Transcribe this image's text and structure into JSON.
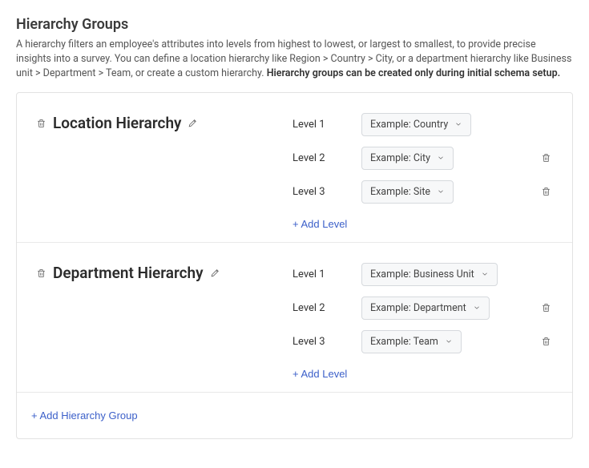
{
  "header": {
    "title": "Hierarchy Groups",
    "description": "A hierarchy filters an employee's attributes into levels from highest to lowest, or largest to smallest, to provide precise insights into a survey. You can define a location hierarchy like Region > Country > City, or a department hierarchy like Business unit > Department > Team, or create a custom hierarchy. ",
    "description_bold": "Hierarchy groups can be created only during initial schema setup."
  },
  "groups": [
    {
      "name": "Location Hierarchy",
      "levels": [
        {
          "label": "Level 1",
          "value": "Example: Country",
          "deletable": false
        },
        {
          "label": "Level 2",
          "value": "Example: City",
          "deletable": true
        },
        {
          "label": "Level 3",
          "value": "Example: Site",
          "deletable": true
        }
      ],
      "add_level_label": "+ Add Level"
    },
    {
      "name": "Department Hierarchy",
      "levels": [
        {
          "label": "Level 1",
          "value": "Example: Business Unit",
          "deletable": false
        },
        {
          "label": "Level 2",
          "value": "Example: Department",
          "deletable": true
        },
        {
          "label": "Level 3",
          "value": "Example: Team",
          "deletable": true
        }
      ],
      "add_level_label": "+ Add Level"
    }
  ],
  "footer": {
    "add_group_label": "+ Add Hierarchy Group"
  }
}
